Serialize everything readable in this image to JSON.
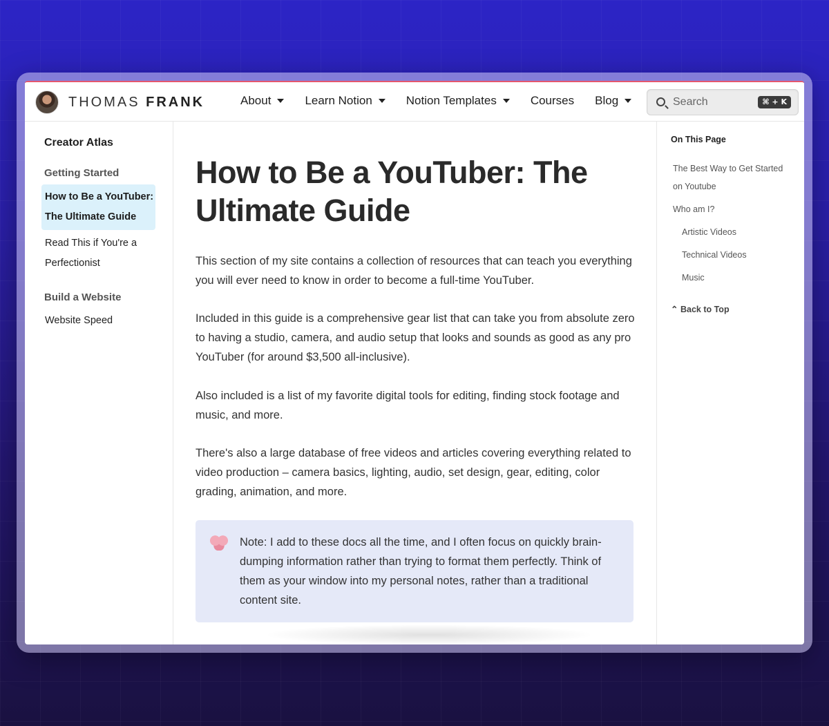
{
  "header": {
    "brand_first": "THOMAS",
    "brand_last": "FRANK",
    "nav": [
      {
        "label": "About",
        "has_dropdown": true
      },
      {
        "label": "Learn Notion",
        "has_dropdown": true
      },
      {
        "label": "Notion Templates",
        "has_dropdown": true
      },
      {
        "label": "Courses",
        "has_dropdown": false
      },
      {
        "label": "Blog",
        "has_dropdown": true
      }
    ],
    "search": {
      "placeholder": "Search",
      "shortcut": "⌘ + K"
    }
  },
  "sidebar": {
    "title": "Creator Atlas",
    "sections": [
      {
        "label": "Getting Started",
        "items": [
          {
            "label": "How to Be a YouTuber: The Ultimate Guide",
            "active": true
          },
          {
            "label": "Read This if You're a Perfectionist",
            "active": false
          }
        ]
      },
      {
        "label": "Build a Website",
        "items": [
          {
            "label": "Website Speed",
            "active": false
          }
        ]
      }
    ]
  },
  "main": {
    "title": "How to Be a YouTuber: The Ultimate Guide",
    "paragraphs": [
      "This section of my site contains a collection of resources that can teach you everything you will ever need to know in order to become a full-time YouTuber.",
      "Included in this guide is a comprehensive gear list that can take you from absolute zero to having a studio, camera, and audio setup that looks and sounds as good as any pro YouTuber (for around $3,500 all-inclusive).",
      "Also included is a list of my favorite digital tools for editing, finding stock footage and music, and more.",
      "There's also a large database of free videos and articles covering everything related to video production – camera basics, lighting, audio, set design, gear, editing, color grading, animation, and more."
    ],
    "note": {
      "icon": "brain-icon",
      "text": "Note: I add to these docs all the time, and I often focus on quickly brain-dumping information rather than trying to format them perfectly. Think of them as your window into my personal notes, rather than a traditional content site."
    }
  },
  "toc": {
    "title": "On This Page",
    "items": [
      {
        "label": "The Best Way to Get Started on Youtube",
        "level": 1
      },
      {
        "label": "Who am I?",
        "level": 1
      },
      {
        "label": "Artistic Videos",
        "level": 2
      },
      {
        "label": "Technical Videos",
        "level": 2
      },
      {
        "label": "Music",
        "level": 2
      }
    ],
    "back_to_top": "Back to Top"
  },
  "colors": {
    "accent_border": "#e4566e",
    "active_item_bg": "#dbf1fb",
    "note_bg": "#e5e9f8"
  }
}
